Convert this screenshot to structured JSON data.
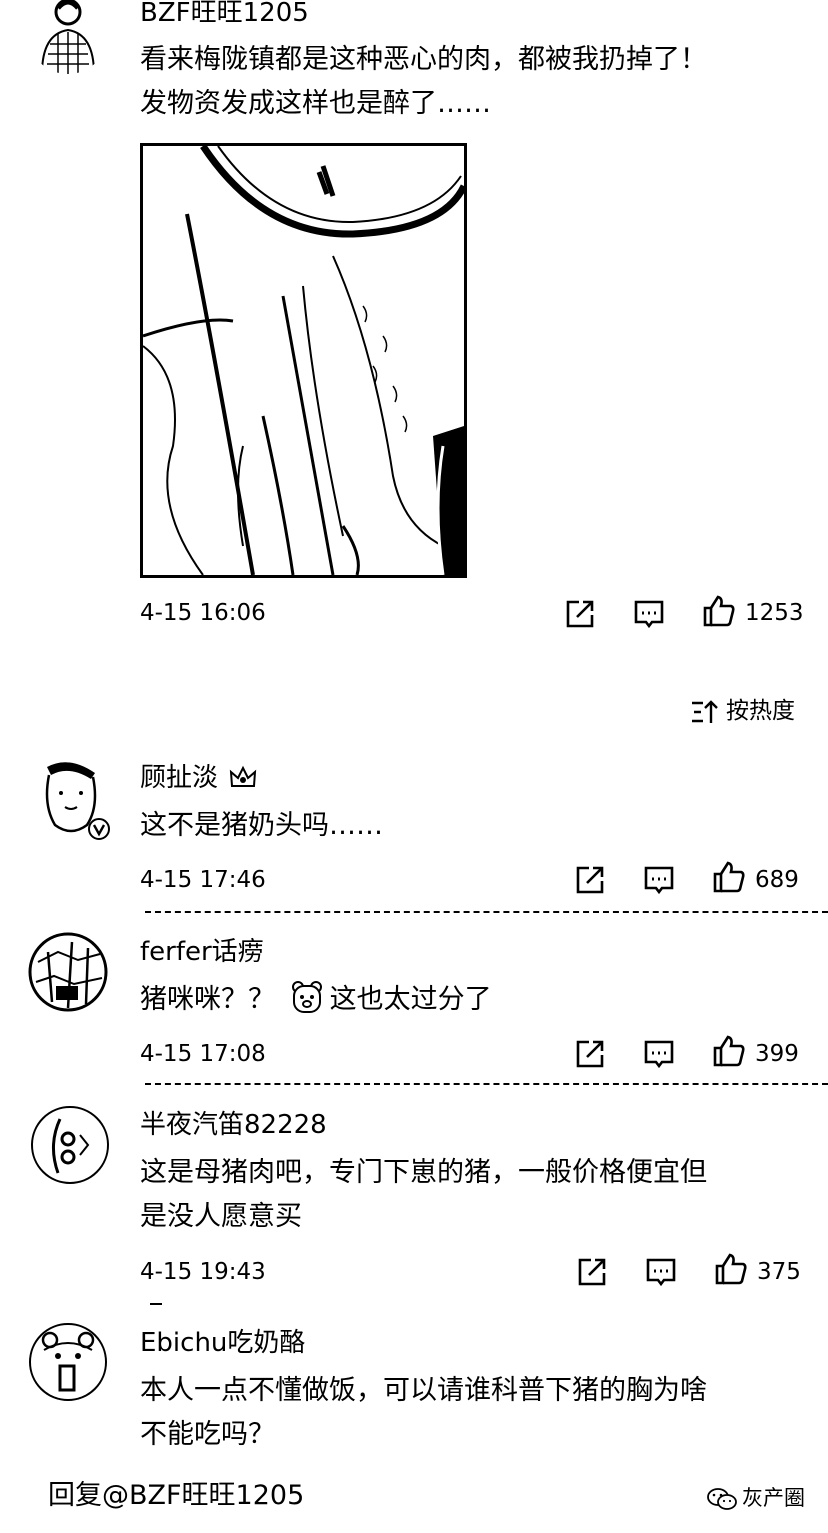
{
  "main_comment": {
    "username": "BZF旺旺1205",
    "text_line1": "看来梅陇镇都是这种恶心的肉，都被我扔掉了！",
    "text_line2": "发物资发成这样也是醉了……",
    "timestamp": "4-15 16:06",
    "likes": "1253"
  },
  "sort": {
    "label": "按热度"
  },
  "replies": [
    {
      "username": "顾扯淡",
      "text_line1": "这不是猪奶头吗……",
      "text_line2": "",
      "timestamp": "4-15 17:46",
      "likes": "689"
    },
    {
      "username": "ferfer话痨",
      "text_line1": "猪咪咪？？",
      "text_after_emoji": "这也太过分了",
      "text_line2": "",
      "timestamp": "4-15 17:08",
      "likes": "399"
    },
    {
      "username": "半夜汽笛82228",
      "text_line1": "这是母猪肉吧，专门下崽的猪，一般价格便宜但",
      "text_line2": "是没人愿意买",
      "timestamp": "4-15 19:43",
      "likes": "375"
    },
    {
      "username": "Ebichu吃奶酪",
      "text_line1": "本人一点不懂做饭，可以请谁科普下猪的胸为啥",
      "text_line2": "不能吃吗？",
      "timestamp": "",
      "likes": ""
    }
  ],
  "reply_bar": {
    "placeholder": "回复@BZF旺旺1205"
  },
  "watermark": {
    "text": "灰产圈"
  },
  "icons": {
    "share": "share-icon",
    "comment": "comment-icon",
    "like": "thumbs-up-icon",
    "sort": "sort-icon",
    "wechat": "wechat-icon"
  },
  "colors": {
    "text": "#000000",
    "background": "#ffffff"
  }
}
